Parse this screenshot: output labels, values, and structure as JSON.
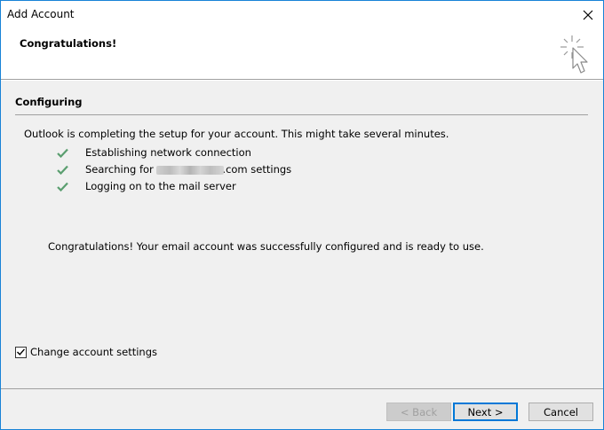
{
  "window": {
    "title": "Add Account",
    "close_icon": "close-icon"
  },
  "header": {
    "title": "Congratulations!",
    "icon": "wizard-sparkle-cursor-icon"
  },
  "section": {
    "title": "Configuring",
    "intro": "Outlook is completing the setup for your account. This might take several minutes.",
    "steps": [
      {
        "label": "Establishing network connection",
        "icon": "checkmark-icon"
      },
      {
        "label_prefix": "Searching for ",
        "label_suffix": ".com settings",
        "icon": "checkmark-icon"
      },
      {
        "label": "Logging on to the mail server",
        "icon": "checkmark-icon"
      }
    ],
    "result": "Congratulations! Your email account was successfully configured and is ready to use."
  },
  "options": {
    "change_settings_label": "Change account settings",
    "change_settings_checked": true
  },
  "buttons": {
    "back": "< Back",
    "next": "Next >",
    "cancel": "Cancel"
  },
  "colors": {
    "check_green": "#5a9e6f",
    "window_border": "#1883d7",
    "default_button_border": "#0078d7"
  }
}
